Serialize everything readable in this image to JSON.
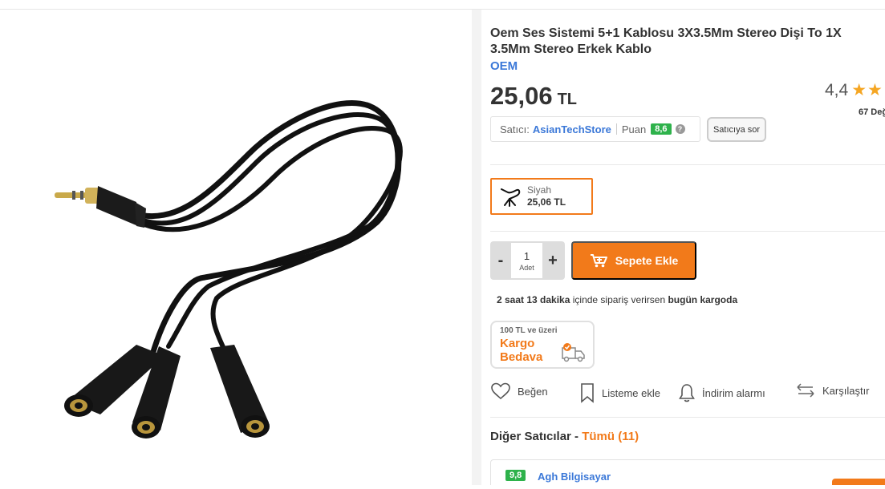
{
  "product": {
    "title": "Oem Ses Sistemi 5+1 Kablosu 3X3.5Mm Stereo Dişi To 1X 3.5Mm Stereo Erkek Kablo",
    "brand": "OEM",
    "price": "25,06",
    "currency": "TL",
    "rating": "4,4",
    "rating_stars": "★★",
    "review_count": "67 Değ",
    "image_icon": "audio-splitter-cable-image"
  },
  "seller": {
    "label": "Satıcı:",
    "name": "AsianTechStore",
    "score_label": "Puan",
    "score": "8,6",
    "help": "?",
    "ask_button": "Satıcıya sor"
  },
  "variant": {
    "name": "Siyah",
    "price": "25,06 TL"
  },
  "cart": {
    "minus": "-",
    "quantity": "1",
    "quantity_label": "Adet",
    "plus": "+",
    "add_button": "Sepete Ekle"
  },
  "delivery": {
    "time": "2 saat 13 dakika",
    "middle": " içinde sipariş verirsen ",
    "when": "bugün kargoda"
  },
  "free_cargo": {
    "threshold": "100 TL ve üzeri",
    "label": "Kargo Bedava"
  },
  "actions": {
    "like": "Beğen",
    "list": "Listeme ekle",
    "alarm": "İndirim alarmı",
    "compare": "Karşılaştır"
  },
  "other_sellers": {
    "title": "Diğer Satıcılar - ",
    "all": "Tümü (11)",
    "first_score": "9,8",
    "first_name": "Agh Bilgisayar"
  },
  "colors": {
    "accent": "#f27a1a",
    "link": "#3b78d8",
    "score_green": "#2eb24b"
  }
}
